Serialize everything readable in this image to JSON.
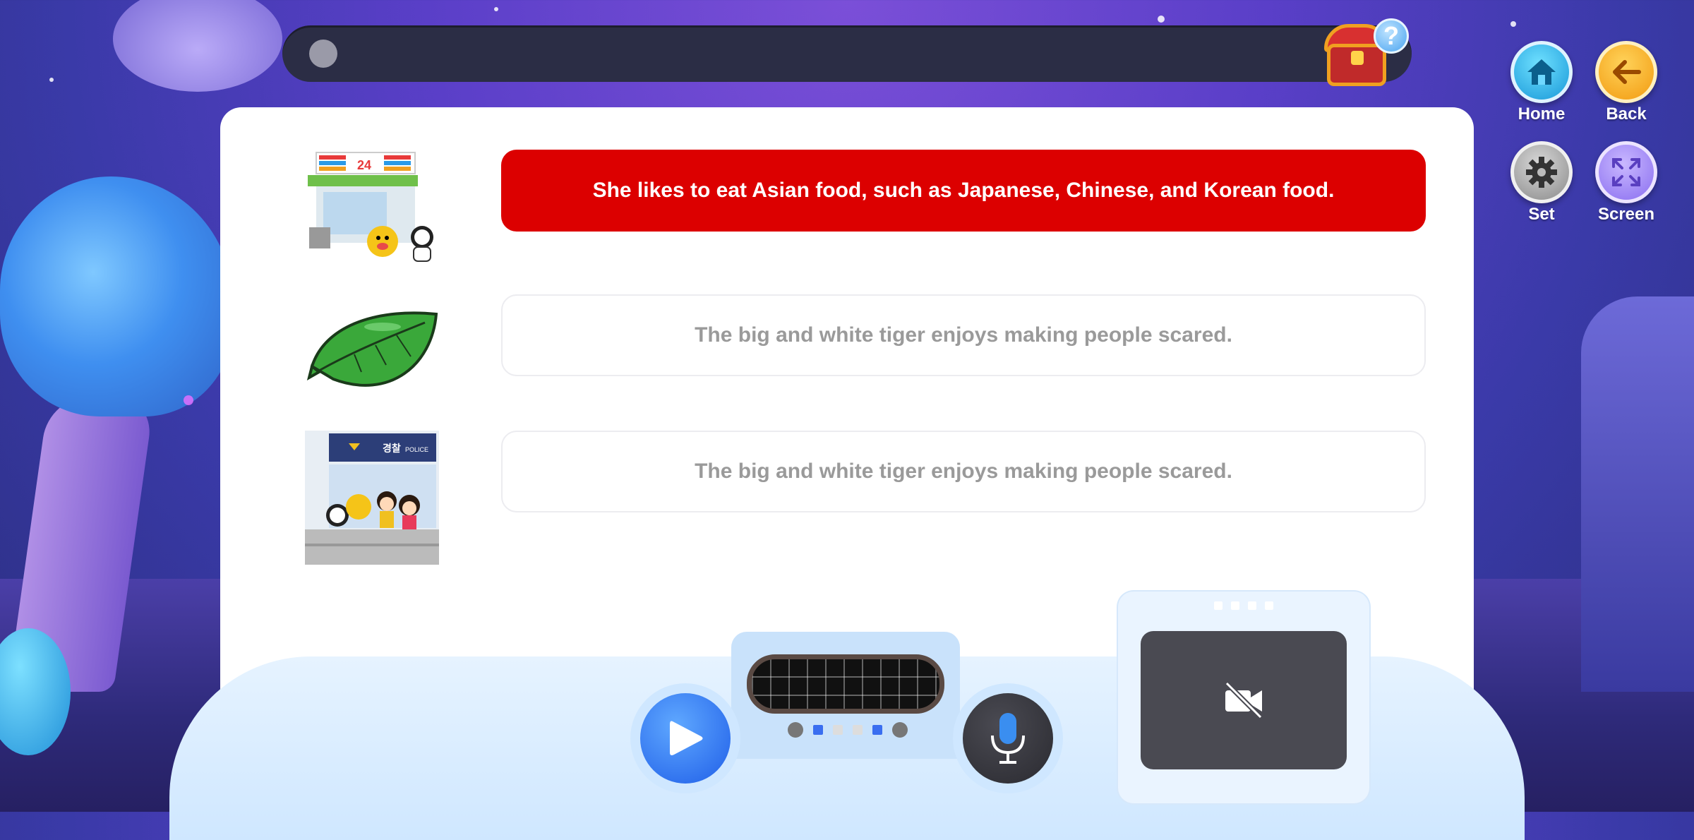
{
  "header": {
    "progress_percent": 0,
    "help_label": "?"
  },
  "nav": {
    "home_label": "Home",
    "back_label": "Back",
    "set_label": "Set",
    "screen_label": "Screen"
  },
  "sentences": [
    {
      "image": "convenience-store-illustration",
      "text": "She likes to eat Asian food, such as Japanese, Chinese, and Korean food.",
      "state": "active"
    },
    {
      "image": "green-leaf-illustration",
      "text": "The big and white tiger enjoys making people scared.",
      "state": "idle"
    },
    {
      "image": "police-station-illustration",
      "text": "The big and white tiger enjoys making people scared.",
      "state": "idle"
    }
  ],
  "police_sign": {
    "korean": "경찰",
    "english": "POLICE"
  },
  "store_sign": "24",
  "controls": {
    "play_icon": "play-icon",
    "mic_icon": "microphone-icon",
    "camera_icon": "camera-off-icon"
  },
  "colors": {
    "active_sentence_bg": "#dc0000",
    "idle_sentence_text": "#9a9a9a",
    "progress_track": "#2b2d45"
  }
}
